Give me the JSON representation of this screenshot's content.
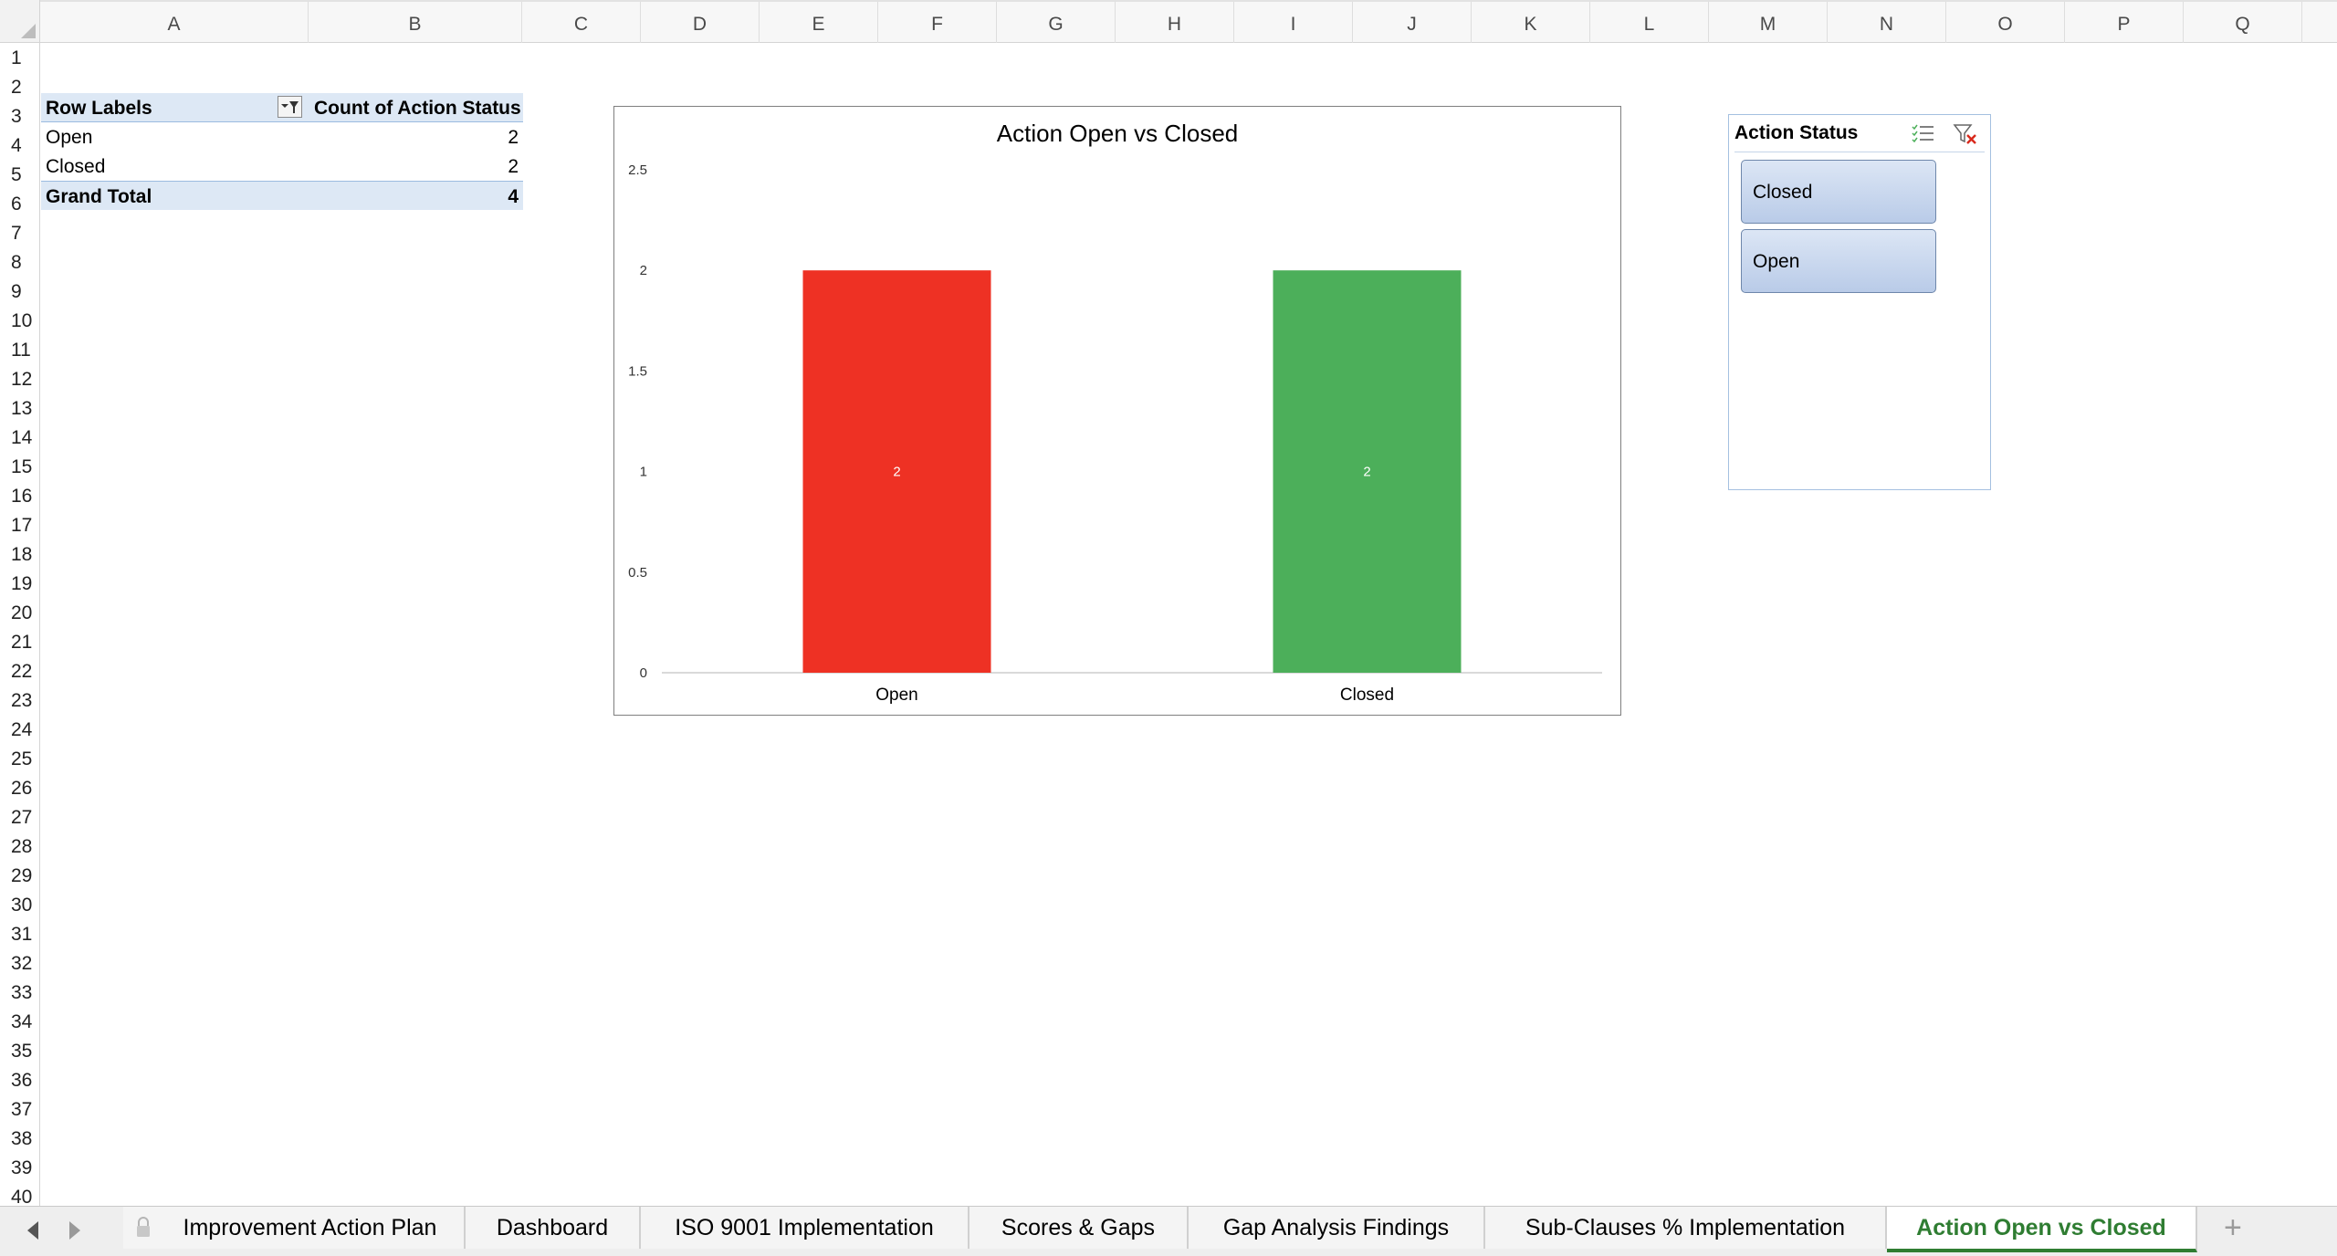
{
  "columns": [
    "A",
    "B",
    "C",
    "D",
    "E",
    "F",
    "G",
    "H",
    "I",
    "J",
    "K",
    "L",
    "M",
    "N",
    "O",
    "P",
    "Q"
  ],
  "rows": [
    "1",
    "2",
    "3",
    "4",
    "5",
    "6",
    "7",
    "8",
    "9",
    "10",
    "11",
    "12",
    "13",
    "14",
    "15",
    "16",
    "17",
    "18",
    "19",
    "20",
    "21",
    "22",
    "23",
    "24",
    "25",
    "26",
    "27",
    "28",
    "29",
    "30",
    "31",
    "32",
    "33",
    "34",
    "35",
    "36",
    "37",
    "38",
    "39",
    "40"
  ],
  "pivot": {
    "header_row_labels": "Row Labels",
    "header_count": "Count of Action Status",
    "rows": [
      {
        "label": "Open",
        "value": "2"
      },
      {
        "label": "Closed",
        "value": "2"
      }
    ],
    "total_label": "Grand Total",
    "total_value": "4"
  },
  "chart_data": {
    "type": "bar",
    "title": "Action Open vs Closed",
    "categories": [
      "Open",
      "Closed"
    ],
    "values": [
      2,
      2
    ],
    "data_labels": [
      "2",
      "2"
    ],
    "bar_colors": [
      "#ee3124",
      "#4caf5a"
    ],
    "ylim": [
      0,
      2.5
    ],
    "yticks": [
      "0",
      "0.5",
      "1",
      "1.5",
      "2",
      "2.5"
    ],
    "xlabel": "",
    "ylabel": "",
    "grid": false,
    "legend": "none"
  },
  "slicer": {
    "title": "Action Status",
    "multiselect_icon": "multi-select-icon",
    "clear_filter_icon": "clear-filter-icon",
    "items": [
      "Closed",
      "Open"
    ]
  },
  "tabs": {
    "nav_prev_icon": "triangle-left-icon",
    "nav_next_icon": "triangle-right-icon",
    "lock_icon": "lock-icon",
    "items": [
      {
        "label": "Improvement Action Plan",
        "active": false
      },
      {
        "label": "Dashboard",
        "active": false
      },
      {
        "label": "ISO 9001 Implementation",
        "active": false
      },
      {
        "label": "Scores & Gaps",
        "active": false
      },
      {
        "label": "Gap Analysis Findings",
        "active": false
      },
      {
        "label": "Sub-Clauses % Implementation",
        "active": false
      },
      {
        "label": "Action Open vs Closed",
        "active": true
      }
    ],
    "add_label": "+",
    "active_color": "#2f7d32"
  }
}
